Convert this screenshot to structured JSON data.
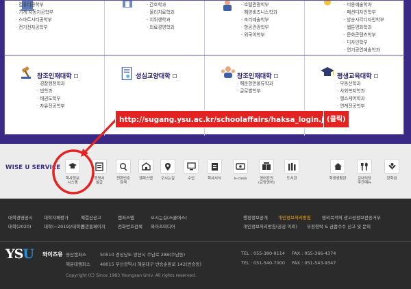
{
  "colleges": {
    "row1": [
      {
        "items": [
          "컴퓨터공학부",
          "기계·자동차공학부",
          "스마트시티공학부",
          "전기전자공학부"
        ]
      },
      {
        "items": [
          "간호학과",
          "물리치료학과",
          "치위생학과",
          "의료경영학과"
        ]
      },
      {
        "items": [
          "호텔관광학부",
          "해양비즈니스학과",
          "조리예술학부",
          "항공관광학부",
          "외국어학부"
        ]
      },
      {
        "items": [
          "미용예술학과",
          "패션디자인학부",
          "방송시각디자인학부",
          "웹툰영화학과",
          "문화콘텐츠학부",
          "디자인학부",
          "연기공연예술학과"
        ]
      }
    ],
    "row2": [
      {
        "title": "창조인재대학",
        "items": [
          "경찰행정학과",
          "법학과",
          "태권도학부",
          "자유전공학부"
        ]
      },
      {
        "title": "성심교양대학",
        "items": []
      },
      {
        "title": "창조인재대학",
        "items": [
          "해운항만물류학과",
          "글로벌학부"
        ]
      },
      {
        "title": "평생교육대학",
        "items": [
          "부동산학과",
          "사회복지학과",
          "헬스케어학과",
          "연계전공학부"
        ]
      }
    ]
  },
  "annotation": {
    "url": "http://sugang.ysu.ac.kr/schoolaffairs/haksa_login.jsp",
    "click": "(클릭)"
  },
  "service": {
    "title": "WISE U SERVICE",
    "items": [
      {
        "label": "학사정보\n시스템",
        "icon": "graduation-cap-icon"
      },
      {
        "label": "증명서\n발급",
        "icon": "certificate-icon"
      },
      {
        "label": "전화번호\n검색",
        "icon": "phone-search-icon"
      },
      {
        "label": "캠퍼스맵",
        "icon": "campus-map-icon"
      },
      {
        "label": "오시는길",
        "icon": "location-pin-icon"
      },
      {
        "label": "수업",
        "icon": "monitor-icon"
      },
      {
        "label": "학사서식",
        "icon": "document-icon"
      },
      {
        "label": "e-class",
        "icon": "eclass-icon"
      },
      {
        "label": "영어강의\n(교양영어)",
        "icon": "english-book-icon"
      },
      {
        "label": "도서관",
        "icon": "library-icon"
      },
      {
        "label": "학생생활관",
        "icon": "dormitory-icon"
      },
      {
        "label": "교내식당\n주간메뉴",
        "icon": "cutlery-icon"
      },
      {
        "label": "장학금",
        "icon": "scholarship-icon"
      }
    ]
  },
  "footer": {
    "links": [
      "대학경영공시",
      "대학자체평가",
      "예결산공고",
      "캠퍼스맵",
      "오시는길(스쿨버스)",
      "행정정보공개",
      "개인정보처리방침",
      "영리목적의 광고성정보전송거부",
      "대학(2020)",
      "대학(~2019)/대학원",
      "기관홈페이지",
      "전화번호검색",
      "와이즈미디어",
      "개인정보처리방침(공공 이외)",
      "부정청탁 & 금품수수 신고 및 문의"
    ],
    "logo_text": "YSU",
    "logo_sub": "와이즈유",
    "campus": [
      {
        "name": "영산캠퍼스",
        "addr": "50510 경상남도 양산시 주남로 288(주남동)",
        "tel": "TEL : 055-380-9114",
        "fax": "FAX : 055-366-4374"
      },
      {
        "name": "해운대캠퍼스",
        "addr": "48015 부산광역시 해운대구 반송순환로 142(반송동)",
        "tel": "TEL : 051-540-7000",
        "fax": "FAX : 051-543-9347"
      }
    ],
    "copyright": "Copyright (C) Since 1983 Youngsan Univ. All rights reserved."
  },
  "colors": {
    "purple": "#3a2a86",
    "red": "#e32222",
    "highlight": "#f2a71b"
  }
}
